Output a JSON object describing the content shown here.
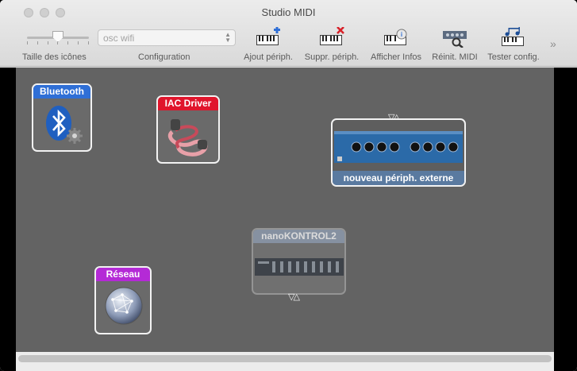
{
  "window": {
    "title": "Studio MIDI"
  },
  "toolbar": {
    "icon_size_label": "Taille des icônes",
    "config_label": "Configuration",
    "config_value": "osc wifi",
    "buttons": [
      {
        "label": "Ajout périph.",
        "icon": "add-device-icon"
      },
      {
        "label": "Suppr. périph.",
        "icon": "remove-device-icon"
      },
      {
        "label": "Afficher Infos",
        "icon": "info-icon"
      },
      {
        "label": "Réinit. MIDI",
        "icon": "rescan-midi-icon"
      },
      {
        "label": "Tester config.",
        "icon": "test-setup-icon"
      }
    ],
    "more": "»"
  },
  "devices": {
    "bluetooth": {
      "label": "Bluetooth",
      "color": "#2f6fd6"
    },
    "iac": {
      "label": "IAC Driver",
      "color": "#e0152c"
    },
    "external": {
      "label": "nouveau périph. externe"
    },
    "nanokontrol": {
      "label": "nanoKONTROL2"
    },
    "network": {
      "label": "Réseau",
      "color": "#b42ad6"
    }
  },
  "port_glyph": "▽△"
}
